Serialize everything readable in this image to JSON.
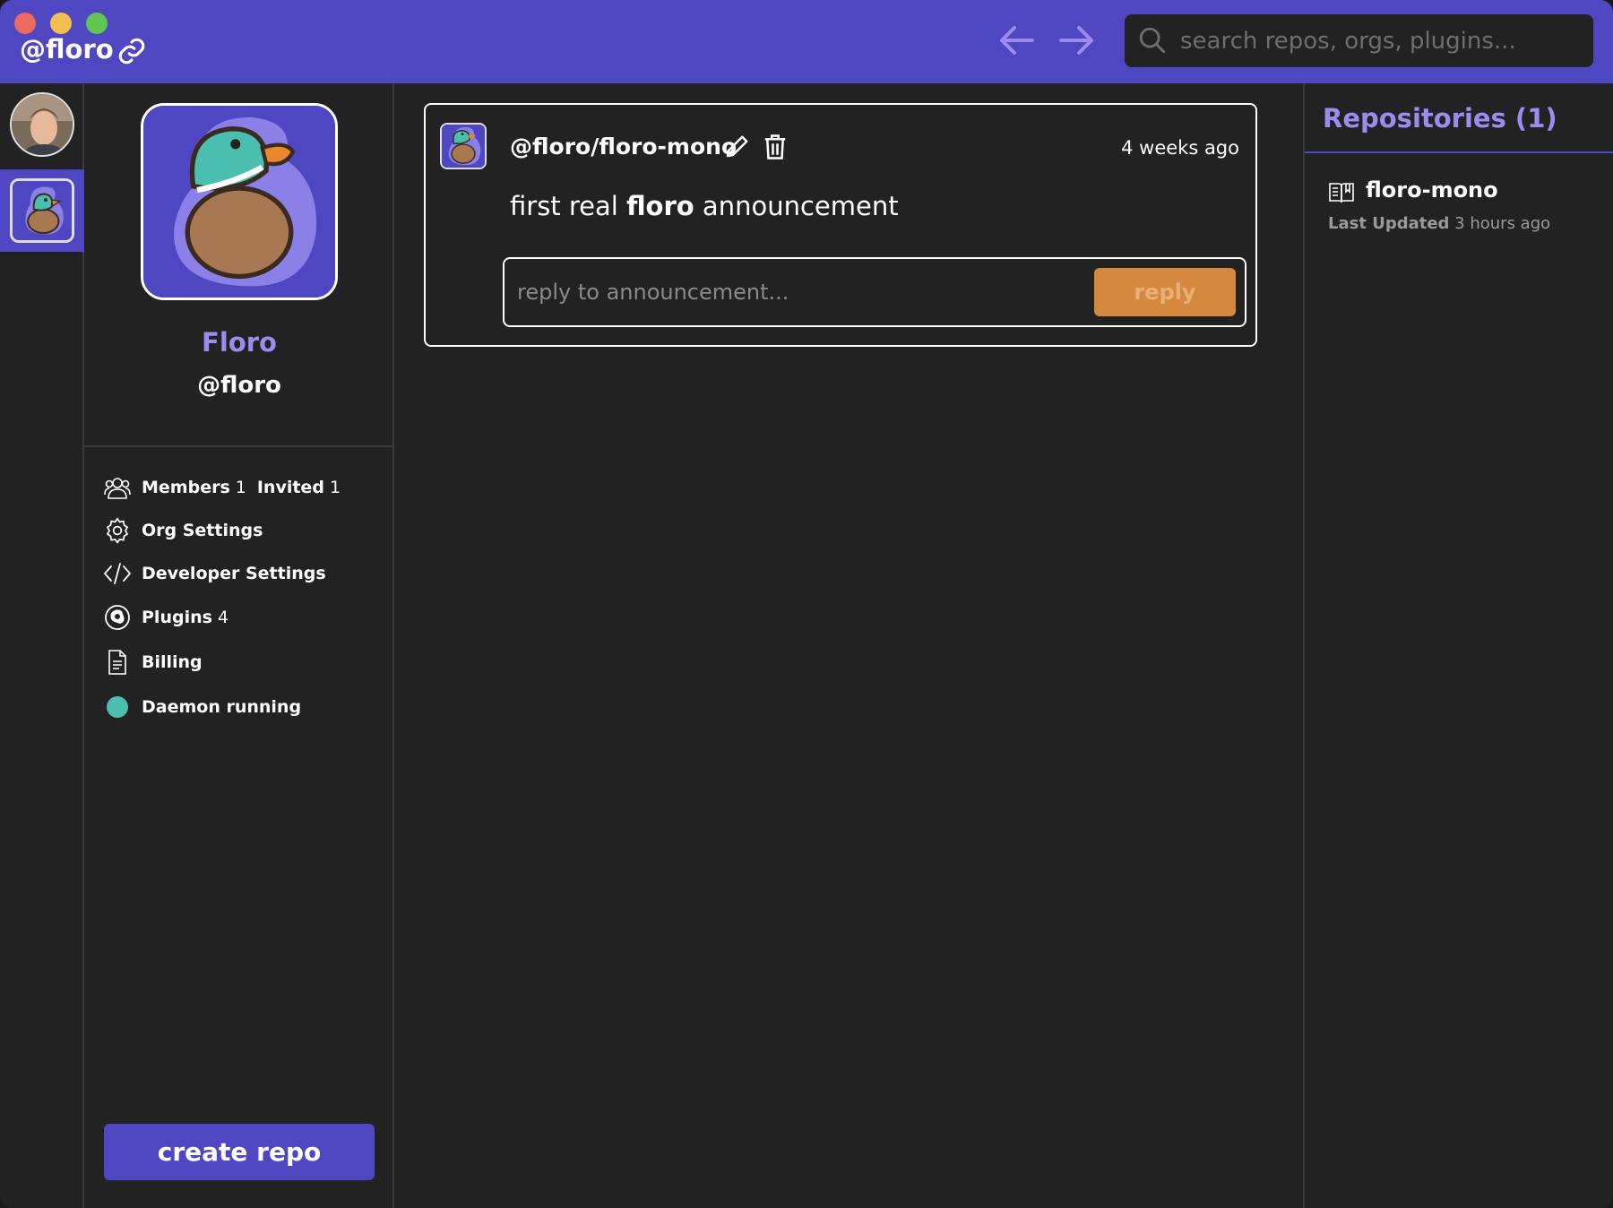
{
  "titlebar": {
    "org_title": "@floro",
    "search_placeholder": "search repos, orgs, plugins..."
  },
  "org": {
    "name": "Floro",
    "handle": "@floro"
  },
  "menu": {
    "members_label": "Members",
    "members_count": "1",
    "invited_label": "Invited",
    "invited_count": "1",
    "org_settings": "Org Settings",
    "developer_settings": "Developer Settings",
    "plugins_label": "Plugins",
    "plugins_count": "4",
    "billing": "Billing",
    "daemon_status": "Daemon running"
  },
  "create_repo_label": "create repo",
  "announcement": {
    "repo": "@floro/floro-mono",
    "time": "4 weeks ago",
    "body_before": "first real ",
    "body_bold": "floro",
    "body_after": " announcement",
    "reply_placeholder": "reply to announcement...",
    "reply_label": "reply"
  },
  "repositories": {
    "title": "Repositories (1)",
    "items": [
      {
        "name": "floro-mono",
        "updated_label": "Last Updated",
        "updated_time": "3 hours ago"
      }
    ]
  },
  "colors": {
    "brand": "#4F46C2",
    "accent_text": "#9C8CF0",
    "daemon": "#4ABFB0",
    "reply_button": "#D4893E",
    "background": "#222222"
  },
  "icons": [
    "link-icon",
    "back-arrow-icon",
    "forward-arrow-icon",
    "search-icon",
    "members-icon",
    "gear-icon",
    "code-icon",
    "plugin-icon",
    "document-icon",
    "pencil-icon",
    "trash-icon",
    "book-icon"
  ]
}
